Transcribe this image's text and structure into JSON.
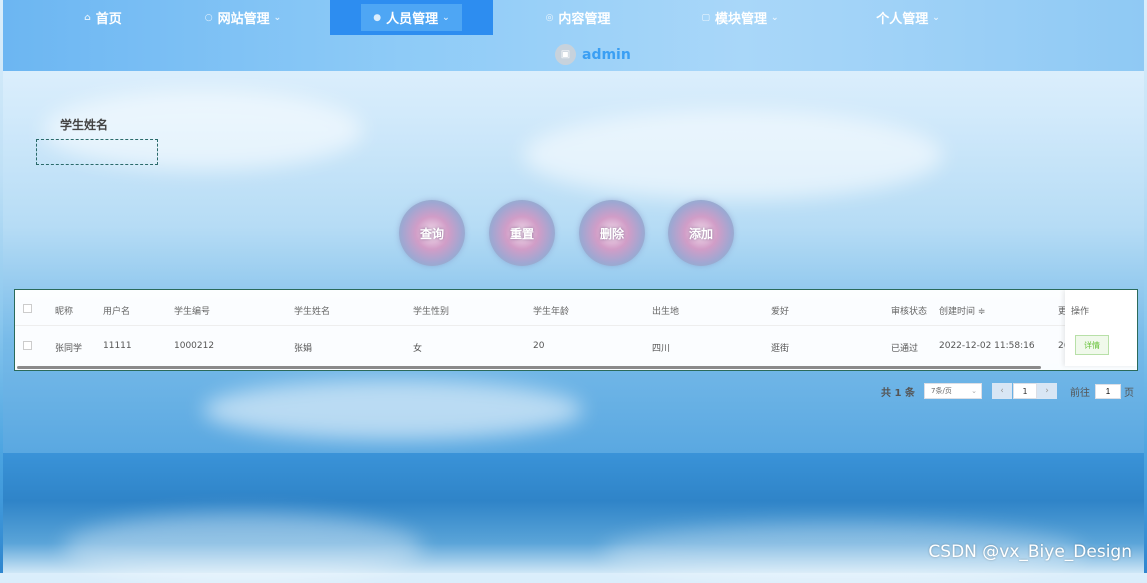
{
  "nav": {
    "items": [
      {
        "label": "首页",
        "icon": "home-icon",
        "caret": false
      },
      {
        "label": "网站管理",
        "icon": "globe-icon",
        "caret": true
      },
      {
        "label": "人员管理",
        "icon": "user-icon",
        "caret": true,
        "active": true
      },
      {
        "label": "内容管理",
        "icon": "content-icon",
        "caret": false
      },
      {
        "label": "模块管理",
        "icon": "module-icon",
        "caret": true
      },
      {
        "label": "个人管理",
        "icon": "",
        "caret": true
      }
    ],
    "username": "admin"
  },
  "search": {
    "label": "学生姓名",
    "value": ""
  },
  "actions": {
    "query": "查询",
    "reset": "重置",
    "delete": "删除",
    "add": "添加"
  },
  "table": {
    "headers": [
      "昵称",
      "用户名",
      "学生编号",
      "学生姓名",
      "学生性别",
      "学生年龄",
      "出生地",
      "爱好",
      "审核状态",
      "创建时间",
      "更",
      "操作"
    ],
    "sort_glyph": "≑",
    "rows": [
      {
        "nickname": "张同学",
        "username": "11111",
        "student_no": "1000212",
        "name": "张娟",
        "gender": "女",
        "age": "20",
        "birthplace": "四川",
        "hobby": "逛街",
        "status": "已通过",
        "created": "2022-12-02 11:58:16",
        "more": "2(",
        "action": "详情"
      }
    ]
  },
  "pagination": {
    "total": "共 1 条",
    "page_size": "7条/页",
    "current": "1",
    "goto_prefix": "前往",
    "goto_value": "1",
    "goto_suffix": "页",
    "prev": "‹",
    "next": "›"
  },
  "watermark": "CSDN @vx_Biye_Design"
}
